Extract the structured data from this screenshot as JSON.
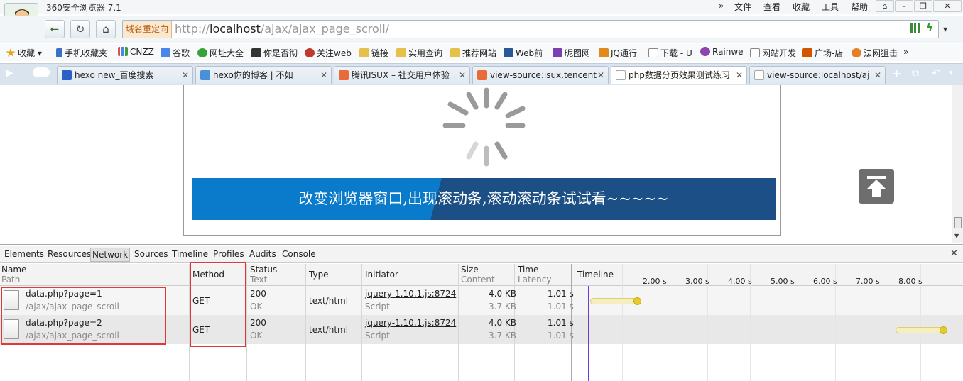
{
  "app": {
    "title": "360安全浏览器 7.1",
    "menus": [
      "文件",
      "查看",
      "收藏",
      "工具",
      "帮助"
    ]
  },
  "address": {
    "redirect_label": "域名重定向",
    "scheme": "http://",
    "host": "localhost",
    "path": "/ajax/ajax_page_scroll/"
  },
  "bookmarks": [
    {
      "label": "收藏",
      "icon": "star-icon",
      "color": "#e8a417"
    },
    {
      "label": "手机收藏夹",
      "icon": "phone-icon",
      "color": "#3b73c4"
    },
    {
      "label": "CNZZ",
      "icon": "chart-icon",
      "color": "#d9534f"
    },
    {
      "label": "谷歌",
      "icon": "google-icon",
      "color": "#4a86e8"
    },
    {
      "label": "网址大全",
      "icon": "globe-icon",
      "color": "#3aa13a"
    },
    {
      "label": "你是否彻",
      "icon": "m-icon",
      "color": "#333333"
    },
    {
      "label": "关注web",
      "icon": "car-icon",
      "color": "#c0392b"
    },
    {
      "label": "链接",
      "icon": "folder-icon",
      "color": "#e5c04a"
    },
    {
      "label": "实用查询",
      "icon": "folder-icon",
      "color": "#e5c04a"
    },
    {
      "label": "推荐网站",
      "icon": "folder-icon",
      "color": "#e5c04a"
    },
    {
      "label": "Web前",
      "icon": "w-icon",
      "color": "#2b5797"
    },
    {
      "label": "昵图网",
      "icon": "image-icon",
      "color": "#7a3fb0"
    },
    {
      "label": "JQ通行",
      "icon": "jq-icon",
      "color": "#e08a1e"
    },
    {
      "label": "下载 - U",
      "icon": "doc-icon",
      "color": "#888888"
    },
    {
      "label": "Rainwe",
      "icon": "apple-icon",
      "color": "#8e44ad"
    },
    {
      "label": "网站开发",
      "icon": "doc-icon",
      "color": "#888888"
    },
    {
      "label": "广场-店",
      "icon": "store-icon",
      "color": "#d35400"
    },
    {
      "label": "法网狙击",
      "icon": "target-icon",
      "color": "#e67e22"
    }
  ],
  "tabs": [
    {
      "label": "hexo new_百度搜索",
      "color": "#2d5fc9",
      "active": false
    },
    {
      "label": "hexo你的博客 | 不如",
      "color": "#4a90d9",
      "active": false
    },
    {
      "label": "腾讯ISUX – 社交用户体验",
      "color": "#e96b3a",
      "active": false
    },
    {
      "label": "view-source:isux.tencent",
      "color": "#e96b3a",
      "active": false
    },
    {
      "label": "php数据分页效果测试练习",
      "color": "#bbbbbb",
      "active": true
    },
    {
      "label": "view-source:localhost/aj",
      "color": "#bbbbbb",
      "active": false
    }
  ],
  "page": {
    "banner_text": "改变浏览器窗口,出现滚动条,滚动滚动条试试看~~~~~"
  },
  "devtools": {
    "tabs": [
      "Elements",
      "Resources",
      "Network",
      "Sources",
      "Timeline",
      "Profiles",
      "Audits",
      "Console"
    ],
    "selected_tab": "Network",
    "columns": {
      "name": "Name",
      "name_sub": "Path",
      "method": "Method",
      "status": "Status",
      "status_sub": "Text",
      "type": "Type",
      "initiator": "Initiator",
      "size": "Size",
      "size_sub": "Content",
      "time": "Time",
      "time_sub": "Latency",
      "timeline": "Timeline"
    },
    "ticks": [
      "2.00 s",
      "3.00 s",
      "4.00 s",
      "5.00 s",
      "6.00 s",
      "7.00 s",
      "8.00 s"
    ],
    "rows": [
      {
        "name": "data.php?page=1",
        "path": "/ajax/ajax_page_scroll",
        "method": "GET",
        "status": "200",
        "status_text": "OK",
        "type": "text/html",
        "initiator": "jquery-1.10.1.js:8724",
        "initiator_sub": "Script",
        "size": "4.0 KB",
        "content": "3.7 KB",
        "time": "1.01 s",
        "latency": "1.01 s"
      },
      {
        "name": "data.php?page=2",
        "path": "/ajax/ajax_page_scroll",
        "method": "GET",
        "status": "200",
        "status_text": "OK",
        "type": "text/html",
        "initiator": "jquery-1.10.1.js:8724",
        "initiator_sub": "Script",
        "size": "4.0 KB",
        "content": "3.7 KB",
        "time": "1.01 s",
        "latency": "1.01 s"
      }
    ]
  }
}
